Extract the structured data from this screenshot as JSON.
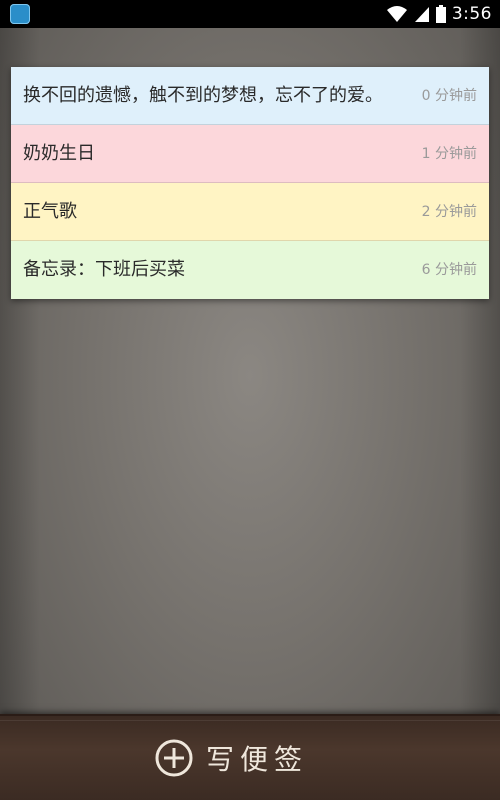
{
  "status_bar": {
    "time": "3:56",
    "icons": [
      "app-icon",
      "wifi-icon",
      "signal-icon",
      "battery-icon"
    ]
  },
  "notes": [
    {
      "title": "换不回的遗憾，触不到的梦想，忘不了的爱。",
      "time": "0 分钟前",
      "color": "#dff0fb"
    },
    {
      "title": "奶奶生日",
      "time": "1 分钟前",
      "color": "#fcd7db"
    },
    {
      "title": "正气歌",
      "time": "2 分钟前",
      "color": "#fff4c4"
    },
    {
      "title": "备忘录：下班后买菜",
      "time": "6 分钟前",
      "color": "#e6f9d9"
    }
  ],
  "bottom_bar": {
    "write_label": "写便签",
    "icon": "plus-circle-icon"
  }
}
